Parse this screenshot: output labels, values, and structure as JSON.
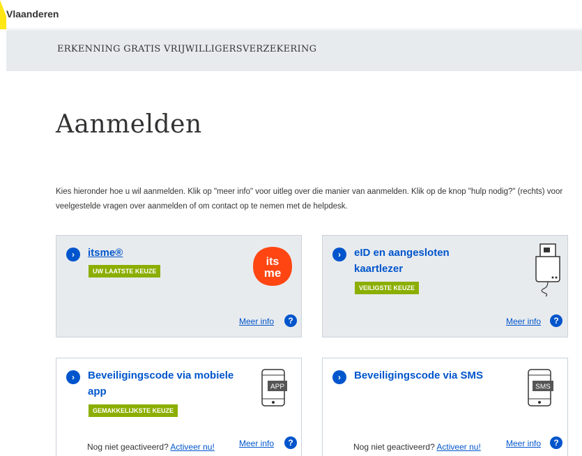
{
  "header": {
    "brand": "Vlaanderen"
  },
  "app": {
    "title": "ERKENNING GRATIS VRIJWILLIGERSVERZEKERING"
  },
  "page": {
    "title": "Aanmelden",
    "intro": "Kies hieronder hoe u wil aanmelden. Klik op \"meer info\" voor uitleg over die manier van aanmelden. Klik op de knop \"hulp nodig?\" (rechts) voor veelgestelde vragen over aanmelden of om contact op te nemen met de helpdesk."
  },
  "options": {
    "itsme": {
      "title": "itsme®",
      "badge": "UW LAATSTE KEUZE",
      "more": "Meer info",
      "logo_line1": "its",
      "logo_line2": "me"
    },
    "eid": {
      "title_line1": "eID en aangesloten",
      "title_line2": "kaartlezer",
      "badge": "VEILIGSTE KEUZE",
      "more": "Meer info"
    },
    "app": {
      "title_line1": "Beveiligingscode via mobiele",
      "title_line2": "app",
      "badge": "GEMAKKELIJKSTE KEUZE",
      "not_activated": "Nog niet geactiveerd?",
      "activate": "Activeer nu!",
      "more": "Meer info",
      "phone_label": "APP"
    },
    "sms": {
      "title": "Beveiligingscode via SMS",
      "not_activated": "Nog niet geactiveerd?",
      "activate": "Activeer nu!",
      "more": "Meer info",
      "phone_label": "SMS"
    }
  },
  "glyphs": {
    "chevron": "›",
    "help": "?"
  },
  "colors": {
    "link": "#0055cc",
    "badge": "#8bae00",
    "itsme": "#ff4612",
    "flag": "#ffe615",
    "grey_bg": "#e8ebee"
  }
}
